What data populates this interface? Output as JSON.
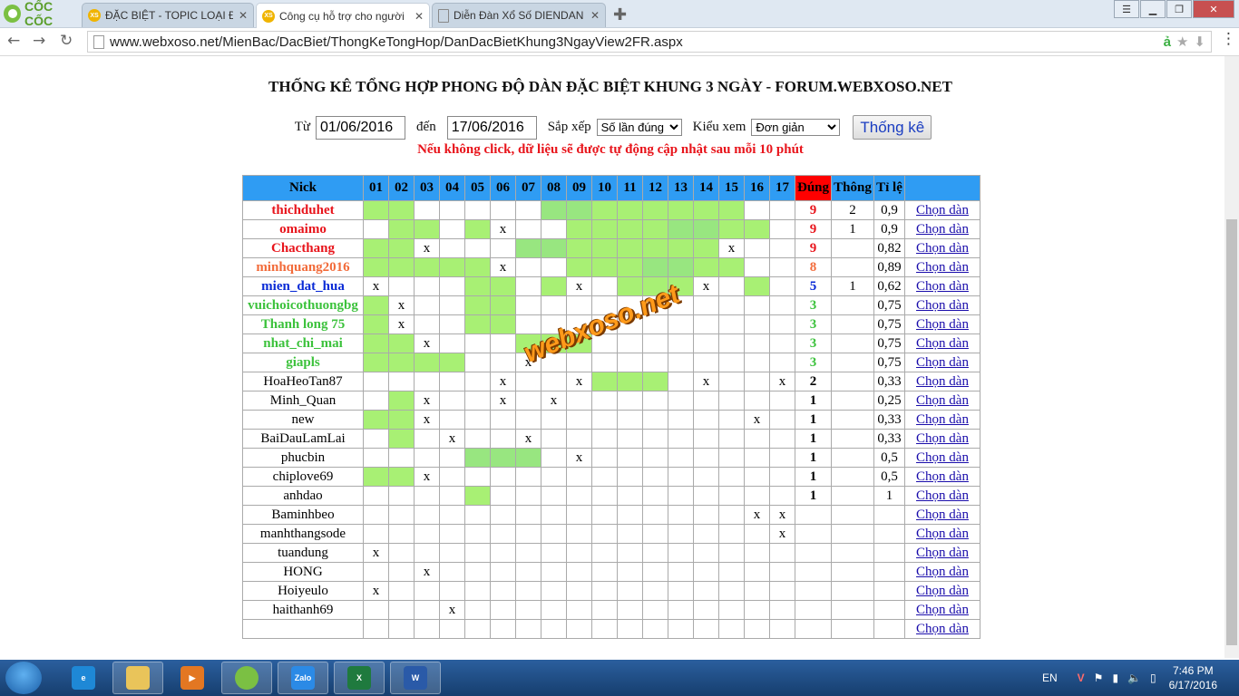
{
  "browser": {
    "brand": "CỐC CỐC",
    "tabs": [
      {
        "title": "ĐẶC BIỆT - TOPIC LOẠI ĐẶC",
        "favicon": "XS"
      },
      {
        "title": "Công cụ hỗ trợ cho người",
        "favicon": "XS"
      },
      {
        "title": "Diễn Đàn Xổ Số DIENDAN",
        "favicon": "doc"
      }
    ],
    "url": "www.webxoso.net/MienBac/DacBiet/ThongKeTongHop/DanDacBietKhung3NgayView2FR.aspx"
  },
  "page": {
    "title": "THỐNG KÊ TỔNG HỢP PHONG ĐỘ DÀN ĐẶC BIỆT KHUNG 3 NGÀY - FORUM.WEBXOSO.NET",
    "from_label": "Từ",
    "from_value": "01/06/2016",
    "to_label": "đến",
    "to_value": "17/06/2016",
    "sort_label": "Sắp xếp",
    "sort_value": "Số lần đúng",
    "view_label": "Kiểu xem",
    "view_value": "Đơn giản",
    "submit_label": "Thống kê",
    "notice": "Nếu không click, dữ liệu sẽ được tự động cập nhật sau mỗi 10 phút",
    "watermark": "webxoso.net"
  },
  "table": {
    "headers": {
      "nick": "Nick",
      "dung": "Đúng",
      "thong": "Thông",
      "tile": "Tỉ lệ"
    },
    "days": [
      "01",
      "02",
      "03",
      "04",
      "05",
      "06",
      "07",
      "08",
      "09",
      "10",
      "11",
      "12",
      "13",
      "14",
      "15",
      "16",
      "17"
    ],
    "link_label": "Chọn dàn",
    "rows": [
      {
        "nick": "thichduhet",
        "color": "red",
        "cells": "gg.....22gggggg",
        "dung": "9",
        "thong": "2",
        "tile": "0,9"
      },
      {
        "nick": "omaimo",
        "color": "red",
        "cells": ".gg.gx..gggg22gg",
        "dung": "9",
        "thong": "1",
        "tile": "0,9"
      },
      {
        "nick": "Chacthang",
        "color": "red",
        "cells": "ggx...22ggggggx",
        "dung": "9",
        "thong": "",
        "tile": "0,82"
      },
      {
        "nick": "minhquang2016",
        "color": "orange",
        "cells": "gggggx..ggg22gg.",
        "dung": "8",
        "thong": "",
        "tile": "0,89"
      },
      {
        "nick": "mien_dat_hua",
        "color": "blue",
        "cells": "x...gg.gx.gggx.g",
        "dung": "5",
        "thong": "1",
        "tile": "0,62"
      },
      {
        "nick": "vuichoicothuongbg",
        "color": "green",
        "cells": "gx..gg...........",
        "dung": "3",
        "thong": "",
        "tile": "0,75"
      },
      {
        "nick": "Thanh long 75",
        "color": "green",
        "cells": "gx..gg...........",
        "dung": "3",
        "thong": "",
        "tile": "0,75"
      },
      {
        "nick": "nhat_chi_mai",
        "color": "green",
        "cells": "ggx...ggg........",
        "dung": "3",
        "thong": "",
        "tile": "0,75"
      },
      {
        "nick": "giapls",
        "color": "green",
        "cells": "gggg..x..........",
        "dung": "3",
        "thong": "",
        "tile": "0,75"
      },
      {
        "nick": "HoaHeoTan87",
        "color": "",
        "cells": ".....x..xggg.x..x.",
        "dung": "2",
        "thong": "",
        "tile": "0,33"
      },
      {
        "nick": "Minh_Quan",
        "color": "",
        "cells": ".gx..x.x.........",
        "dung": "1",
        "thong": "",
        "tile": "0,25"
      },
      {
        "nick": "new",
        "color": "",
        "cells": "ggx............x.",
        "dung": "1",
        "thong": "",
        "tile": "0,33"
      },
      {
        "nick": "BaiDauLamLai",
        "color": "",
        "cells": ".g.x..x..........",
        "dung": "1",
        "thong": "",
        "tile": "0,33"
      },
      {
        "nick": "phucbin",
        "color": "",
        "cells": "....222.x........",
        "dung": "1",
        "thong": "",
        "tile": "0,5"
      },
      {
        "nick": "chiplove69",
        "color": "",
        "cells": "ggx..............",
        "dung": "1",
        "thong": "",
        "tile": "0,5"
      },
      {
        "nick": "anhdao",
        "color": "",
        "cells": "....g............",
        "dung": "1",
        "thong": "",
        "tile": "1"
      },
      {
        "nick": "Baminhbeo",
        "color": "",
        "cells": "...............xx",
        "dung": "",
        "thong": "",
        "tile": ""
      },
      {
        "nick": "manhthangsode",
        "color": "",
        "cells": "................x",
        "dung": "",
        "thong": "",
        "tile": ""
      },
      {
        "nick": "tuandung",
        "color": "",
        "cells": "x................",
        "dung": "",
        "thong": "",
        "tile": ""
      },
      {
        "nick": "HONG",
        "color": "",
        "cells": "..x..............",
        "dung": "",
        "thong": "",
        "tile": ""
      },
      {
        "nick": "Hoiyeulo",
        "color": "",
        "cells": "x................",
        "dung": "",
        "thong": "",
        "tile": ""
      },
      {
        "nick": "haithanh69",
        "color": "",
        "cells": "...x.............",
        "dung": "",
        "thong": "",
        "tile": ""
      },
      {
        "nick": "",
        "color": "",
        "cells": ".................",
        "dung": "",
        "thong": "",
        "tile": ""
      }
    ]
  },
  "taskbar": {
    "language": "EN",
    "time": "7:46 PM",
    "date": "6/17/2016",
    "apps": [
      "ie-icon",
      "file-explorer-icon",
      "media-player-icon",
      "coccoc-icon",
      "zalo-icon",
      "excel-icon",
      "word-icon"
    ]
  }
}
